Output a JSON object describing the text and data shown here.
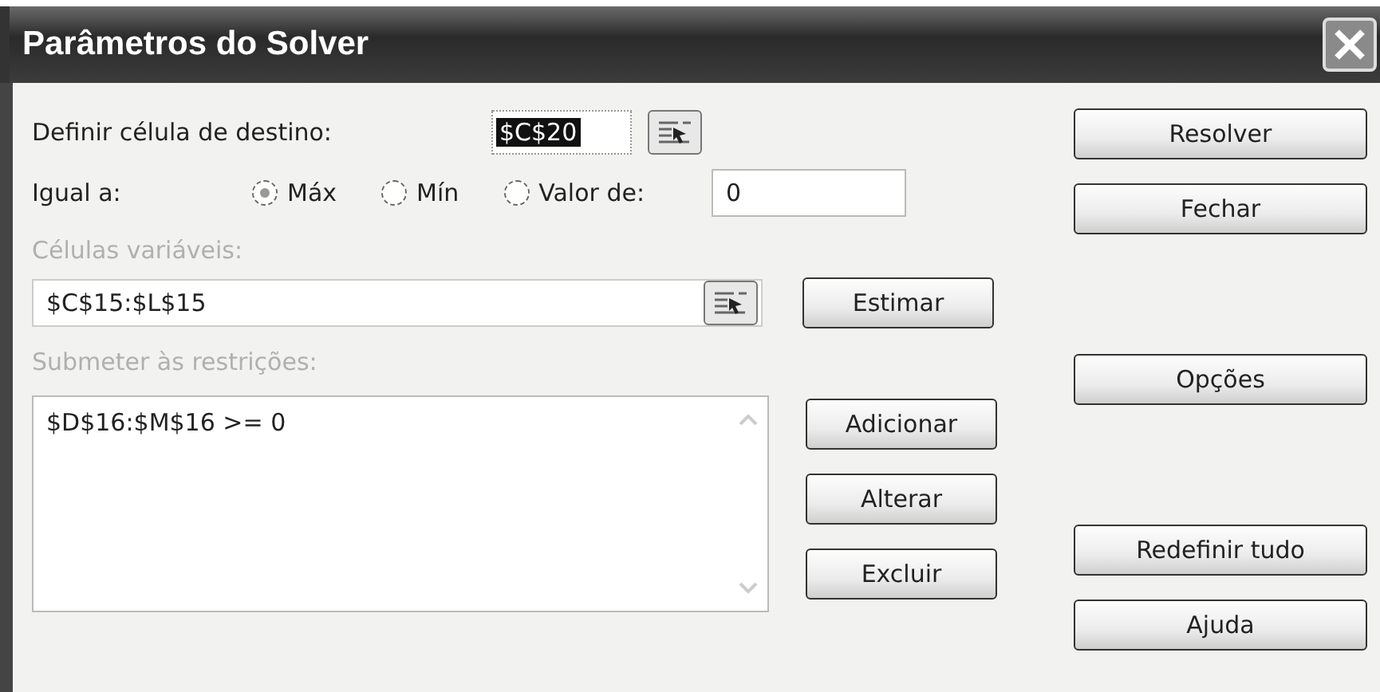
{
  "window": {
    "title": "Parâmetros do Solver"
  },
  "target_cell": {
    "label": "Definir célula de destino:",
    "value": "$C$20"
  },
  "equal_to": {
    "label": "Igual a:",
    "options": [
      {
        "label": "Máx",
        "selected": true
      },
      {
        "label": "Mín",
        "selected": false
      },
      {
        "label": "Valor de:",
        "selected": false
      }
    ],
    "value": "0"
  },
  "changing_cells": {
    "label": "Células variáveis:",
    "disabled": true,
    "value": "$C$15:$L$15",
    "button": "Estimar"
  },
  "constraints": {
    "label": "Submeter às restrições:",
    "disabled": true,
    "items": [
      "$D$16:$M$16 >= 0"
    ],
    "buttons": [
      "Adicionar",
      "Alterar",
      "Excluir"
    ]
  },
  "side_buttons": [
    "Resolver",
    "Fechar",
    "Opções",
    "Redefinir tudo",
    "Ajuda"
  ]
}
